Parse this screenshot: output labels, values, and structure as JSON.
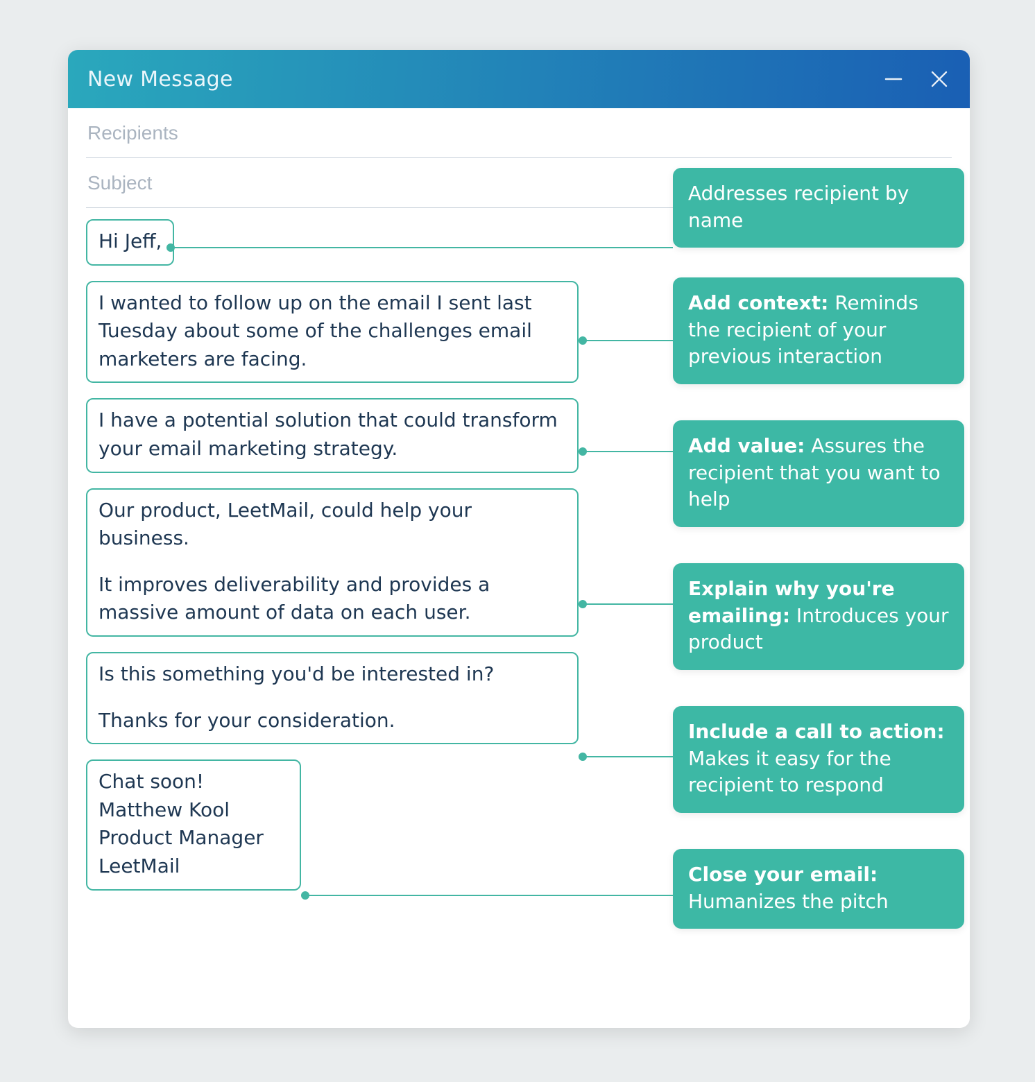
{
  "header": {
    "title": "New Message"
  },
  "fields": {
    "recipients_placeholder": "Recipients",
    "subject_placeholder": "Subject"
  },
  "blocks": {
    "salutation": "Hi Jeff,",
    "context": "I wanted to follow up on the email I sent last Tuesday about some of the challenges email marketers are facing.",
    "value": "I have a potential solution that could transform  your email marketing strategy.",
    "why_p1": "Our product, LeetMail, could help your business.",
    "why_p2": "It improves deliverability and provides a massive amount of data on each user.",
    "cta_p1": "Is this something you'd be interested in?",
    "cta_p2": "Thanks for your consideration.",
    "sig_l1": "Chat soon!",
    "sig_l2": "Matthew Kool",
    "sig_l3": "Product Manager",
    "sig_l4": "LeetMail"
  },
  "callouts": {
    "c1_text": "Addresses recipient by name",
    "c2_bold": "Add context:",
    "c2_text": " Reminds the recipient of your previous interaction",
    "c3_bold": "Add value:",
    "c3_text": " Assures the recipient that you want to help",
    "c4_bold": "Explain why you're emailing:",
    "c4_text": " Introduces your product",
    "c5_bold": "Include a call to action:",
    "c5_text": " Makes it easy for the recipient to respond",
    "c6_bold": "Close your email:",
    "c6_text": " Humanizes the pitch"
  }
}
